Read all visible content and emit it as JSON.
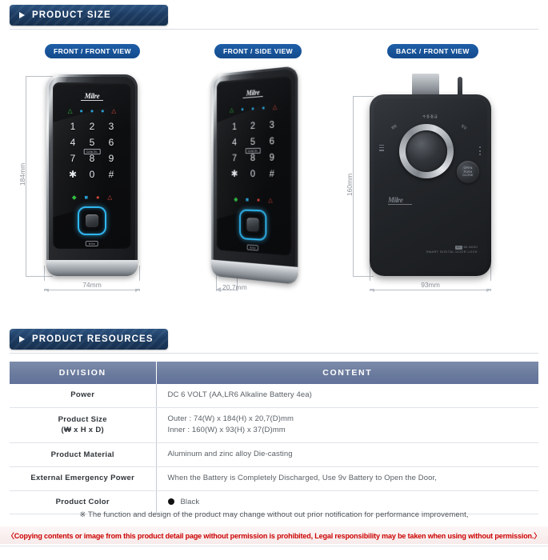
{
  "sections": {
    "size": {
      "title": "PRODUCT SIZE"
    },
    "resources": {
      "title": "PRODUCT RESOURCES"
    }
  },
  "views": [
    {
      "id": "front-front",
      "label": "FRONT / FRONT VIEW",
      "height_dim": "184mm",
      "width_dim": "74mm"
    },
    {
      "id": "front-side",
      "label": "FRONT / SIDE VIEW",
      "width_dim": "20,7mm"
    },
    {
      "id": "back-front",
      "label": "BACK / FRONT VIEW",
      "height_dim": "160mm",
      "width_dim": "93mm"
    }
  ],
  "device": {
    "brand": "Milre",
    "keys": [
      "1",
      "2",
      "3",
      "4",
      "5",
      "6",
      "7",
      "8",
      "9",
      "✱",
      "0",
      "#"
    ],
    "cancel_chip_label": "CANCEL",
    "bottom_tag": "Milre",
    "back": {
      "knob_hangul": "수동잠금",
      "knob_left_text": "열림",
      "knob_right_text": "잠김",
      "open_label": "OPEN",
      "close_label": "CLOSE",
      "middle_label": "PUSH",
      "model_code": "MI-6000",
      "model_name": "SMART DIGITAL DOOR LOCK",
      "kc_mark": "KC"
    },
    "status_icons_top": [
      {
        "name": "lock-status-icon",
        "glyph": "▲",
        "color": "#2ecc40"
      },
      {
        "name": "wifi-signal-icon",
        "glyph": "●",
        "color": "#29a8e0"
      },
      {
        "name": "bluetooth-icon",
        "glyph": "●",
        "color": "#29a8e0"
      },
      {
        "name": "network-icon",
        "glyph": "●",
        "color": "#29a8e0"
      },
      {
        "name": "alarm-bell-icon",
        "glyph": "▲",
        "color": "#e74c3c"
      }
    ],
    "status_icons_bottom": [
      {
        "name": "mute-icon",
        "glyph": "◆",
        "color": "#2ecc40"
      },
      {
        "name": "signal-icon",
        "glyph": "■",
        "color": "#29a8e0"
      },
      {
        "name": "battery-low-icon",
        "glyph": "●",
        "color": "#e74c3c"
      },
      {
        "name": "warning-icon",
        "glyph": "▲",
        "color": "#e74c3c"
      }
    ]
  },
  "spec_table": {
    "headers": [
      "DIVISION",
      "CONTENT"
    ],
    "rows": [
      {
        "division": "Power",
        "division_sub": "",
        "content": "DC 6 VOLT (AA,LR6 Alkaline Battery 4ea)",
        "content_line2": ""
      },
      {
        "division": "Product Size",
        "division_sub": "(₩ x H x D)",
        "content": "Outer : 74(W) x 184(H) x 20,7(D)mm",
        "content_line2": "Inner : 160(W) x 93(H) x 37(D)mm"
      },
      {
        "division": "Product Material",
        "division_sub": "",
        "content": "Aluminum and zinc alloy Die-casting",
        "content_line2": ""
      },
      {
        "division": "External Emergency Power",
        "division_sub": "",
        "content": "When the Battery is Completely Discharged, Use 9v Battery to Open the Door,",
        "content_line2": ""
      },
      {
        "division": "Product Color",
        "division_sub": "",
        "content": "Black",
        "content_line2": "",
        "swatch": "#111111"
      }
    ]
  },
  "footer": {
    "change_note": "※ The function and design of the product may change without out prior notification for performance improvement,",
    "copyright": "〈Copying contents or image from this product detail page without permission is prohibited, Legal responsibility may be taken when using without permission.〉"
  },
  "colors": {
    "banner_blue": "#1d3c63",
    "pill_blue": "#134a8c",
    "table_header": "#6b7b9d",
    "copyright_red": "#cc0000"
  }
}
